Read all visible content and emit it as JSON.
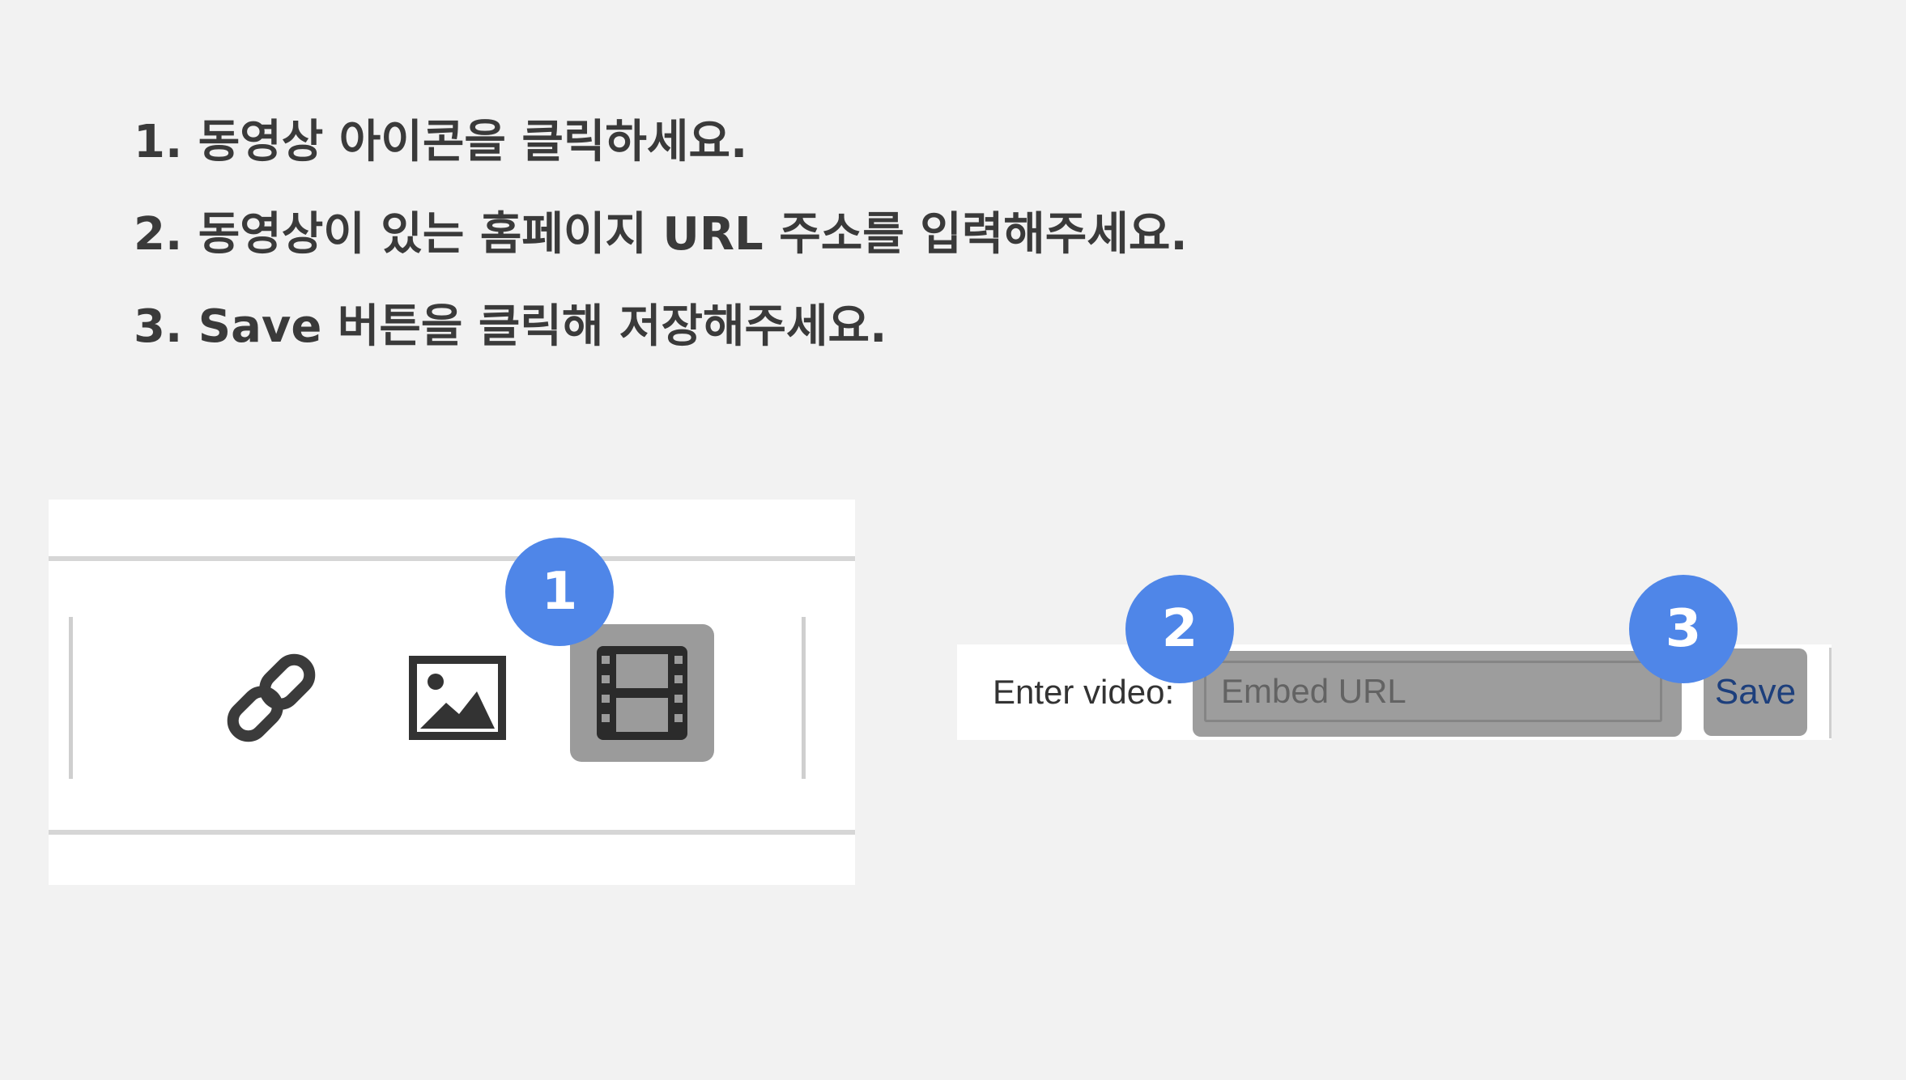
{
  "instructions": [
    "1. 동영상 아이콘을 클릭하세요.",
    "2. 동영상이 있는 홈페이지 URL 주소를 입력해주세요.",
    "3. Save 버튼을 클릭해 저장해주세요."
  ],
  "toolbar": {
    "icons": [
      "link-icon",
      "image-icon",
      "video-icon"
    ],
    "active_tool": "video-icon"
  },
  "embed": {
    "label": "Enter video:",
    "placeholder": "Embed URL",
    "value": "",
    "save_label": "Save"
  },
  "badges": [
    "1",
    "2",
    "3"
  ],
  "colors": {
    "background": "#f2f2f2",
    "badge": "#4f86e8",
    "highlight": "#9d9d9d",
    "save_text": "#1d3f7c"
  }
}
